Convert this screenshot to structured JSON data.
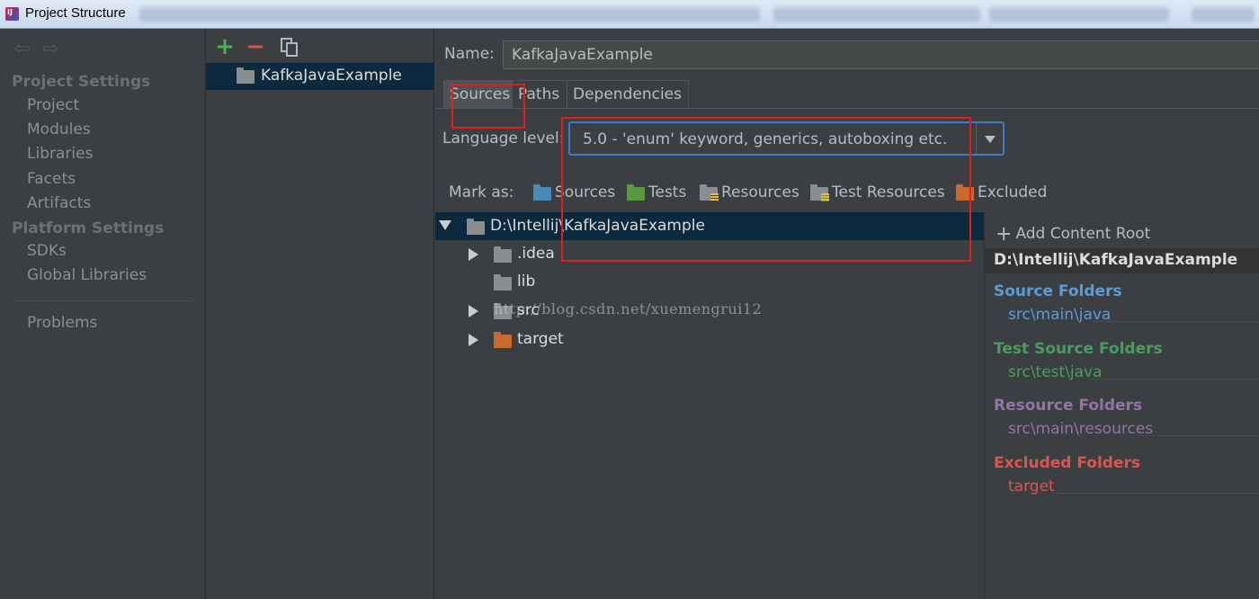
{
  "window": {
    "title": "Project Structure"
  },
  "sidebar": {
    "project_settings_title": "Project Settings",
    "project_items": [
      "Project",
      "Modules",
      "Libraries",
      "Facets",
      "Artifacts"
    ],
    "platform_settings_title": "Platform Settings",
    "platform_items": [
      "SDKs",
      "Global Libraries"
    ],
    "problems": "Problems"
  },
  "modules": {
    "selected": "KafkaJavaExample"
  },
  "main": {
    "name_label": "Name:",
    "name_value": "KafkaJavaExample",
    "tabs": [
      "Sources",
      "Paths",
      "Dependencies"
    ],
    "language_level_label": "Language level:",
    "language_level_value": "5.0 - 'enum' keyword, generics, autoboxing etc.",
    "mark_as_label": "Mark as:",
    "mark_as": [
      "Sources",
      "Tests",
      "Resources",
      "Test Resources",
      "Excluded"
    ]
  },
  "tree": {
    "root": "D:\\Intellij\\KafkaJavaExample",
    "children": [
      ".idea",
      "lib",
      "src",
      "target"
    ]
  },
  "watermark": "http://blog.csdn.net/xuemengrui12",
  "content_root": {
    "add_label": "Add Content Root",
    "path": "D:\\Intellij\\KafkaJavaExample",
    "source_title": "Source Folders",
    "source_path": "src\\main\\java",
    "test_title": "Test Source Folders",
    "test_path": "src\\test\\java",
    "resource_title": "Resource Folders",
    "resource_path": "src\\main\\resources",
    "excluded_title": "Excluded Folders",
    "excluded_path": "target"
  },
  "colors": {
    "source": "#5c9bd6",
    "test": "#4f9a63",
    "resource": "#9473a8",
    "excluded": "#e0524f",
    "selection": "#0d293e",
    "annotation": "#e02020"
  }
}
